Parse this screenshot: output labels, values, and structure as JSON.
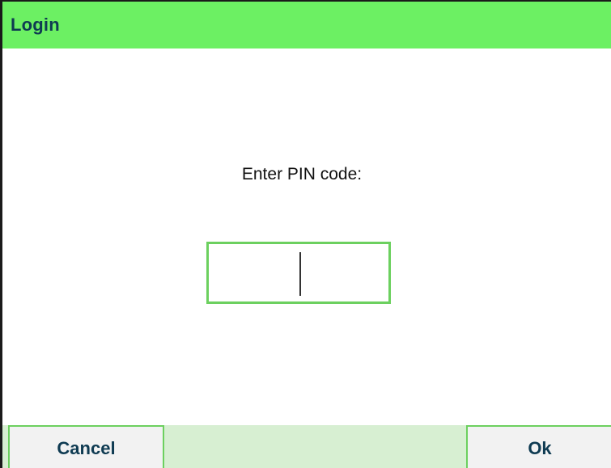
{
  "window": {
    "title": "Login"
  },
  "dialog": {
    "prompt": "Enter PIN code:",
    "pin_value": ""
  },
  "softkeys": {
    "cancel_label": "Cancel",
    "ok_label": "Ok"
  },
  "colors": {
    "title_bar": "#6cf063",
    "title_text": "#0f3b52",
    "field_border": "#6cd05f",
    "bottom_bar": "#d7efd2",
    "softkey_bg": "#f2f2f2"
  }
}
